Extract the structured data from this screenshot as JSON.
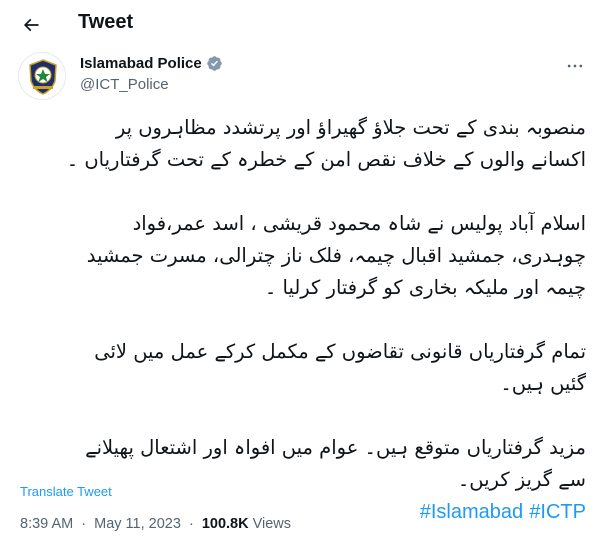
{
  "header": {
    "title": "Tweet"
  },
  "author": {
    "display_name": "Islamabad Police",
    "handle": "@ICT_Police"
  },
  "tweet": {
    "paragraphs": [
      "منصوبہ بندی کے تحت جلاؤ گھیراؤ اور پرتشدد مظاہروں پر\nاکسانے والوں کے خلاف نقص امن کے خطرہ کے تحت گرفتاریاں ۔",
      "اسلام آباد پولیس نے شاہ محمود قریشی ، اسد عمر،فواد\nچوہدری، جمشید اقبال چیمہ، فلک ناز چترالی، مسرت جمشید\nچیمہ اور ملیکہ بخاری کو گرفتار کرلیا ۔",
      "تمام گرفتاریاں قانونی تقاضوں کے مکمل کرکے عمل میں لائی\nگئیں ہیں۔",
      "مزید گرفتاریاں متوقع ہیں۔ عوام میں افواہ اور اشتعال پھیلانے\nسے گریز کریں۔"
    ],
    "hashtags": [
      "#Islamabad",
      "#ICTP"
    ]
  },
  "translate_label": "Translate Tweet",
  "meta": {
    "time": "8:39 AM",
    "separator": "·",
    "date": "May 11, 2023",
    "views_count": "100.8K",
    "views_label": "Views"
  },
  "colors": {
    "accent": "#1d9bf0",
    "text": "#0f1419",
    "secondary": "#536471",
    "verified": "#829aab"
  },
  "icons": {
    "back": "arrow-left-icon",
    "verified": "verified-badge-icon",
    "more": "more-horizontal-icon",
    "avatar": "police-emblem-icon"
  }
}
